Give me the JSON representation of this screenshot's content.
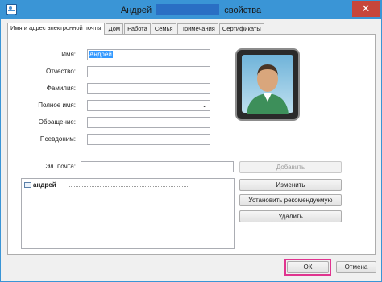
{
  "window": {
    "title_name": "Андрей",
    "title_suffix": "свойства",
    "close_glyph": "✕",
    "accent": "#3a95d6",
    "close_color": "#c7463b"
  },
  "tabs": [
    {
      "label": "Имя и адрес электронной почты",
      "active": true
    },
    {
      "label": "Дом"
    },
    {
      "label": "Работа"
    },
    {
      "label": "Семья"
    },
    {
      "label": "Примечания"
    },
    {
      "label": "Сертификаты"
    }
  ],
  "form": {
    "first_name": {
      "label": "Имя:",
      "value": "Андрей"
    },
    "middle_name": {
      "label": "Отчество:",
      "value": ""
    },
    "last_name": {
      "label": "Фамилия:",
      "value": ""
    },
    "full_name": {
      "label": "Полное имя:",
      "value": ""
    },
    "title": {
      "label": "Обращение:",
      "value": ""
    },
    "nickname": {
      "label": "Псевдоним:",
      "value": ""
    },
    "email": {
      "label": "Эл. почта:",
      "value": ""
    }
  },
  "email_list": [
    {
      "address": "андрей",
      "icon": "mail-icon"
    }
  ],
  "buttons": {
    "add": "Добавить",
    "edit": "Изменить",
    "set_default": "Установить рекомендуемую",
    "remove": "Удалить",
    "ok": "ОК",
    "cancel": "Отмена"
  },
  "icons": {
    "avatar": "contact-avatar-icon",
    "dropdown": "chevron-down-icon"
  },
  "highlight_color": "#e0358f"
}
